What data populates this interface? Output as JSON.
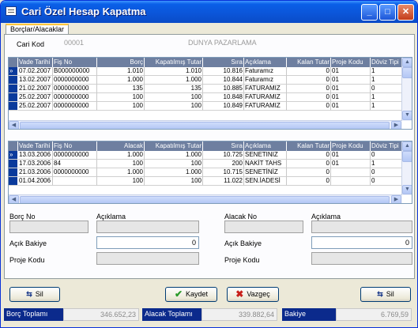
{
  "window": {
    "title": "Cari Özel Hesap Kapatma",
    "minimize": "_",
    "maximize": "□",
    "close": "✕"
  },
  "tab": "Borçlar/Alacaklar",
  "cari": {
    "label": "Cari Kod",
    "code": "00001",
    "name": "DUNYA PAZARLAMA"
  },
  "grid1": {
    "columns": [
      "Vade Tarihi",
      "Fiş No",
      "Borç",
      "Kapatılmış Tutar",
      "Sıra",
      "Açıklama",
      "Kalan Tutar",
      "Proje Kodu",
      "Döviz Tipi"
    ],
    "rows": [
      [
        "07.02.2007",
        "B000000000",
        "1.010",
        "1.010",
        "10.816",
        "Faturamız",
        "0",
        "01",
        "1"
      ],
      [
        "13.02.2007",
        "0000000000",
        "1.000",
        "1.000",
        "10.844",
        "Faturamız",
        "0",
        "01",
        "1"
      ],
      [
        "21.02.2007",
        "0000000000",
        "135",
        "135",
        "10.885",
        "FATURAMIZ",
        "0",
        "01",
        "0"
      ],
      [
        "25.02.2007",
        "0000000000",
        "100",
        "100",
        "10.848",
        "FATURAMIZ",
        "0",
        "01",
        "1"
      ],
      [
        "25.02.2007",
        "0000000000",
        "100",
        "100",
        "10.849",
        "FATURAMIZ",
        "0",
        "01",
        "1"
      ]
    ]
  },
  "grid2": {
    "columns": [
      "Vade Tarihi",
      "Fiş No",
      "Alacak",
      "Kapatılmış Tutar",
      "Sıra",
      "Açıklama",
      "Kalan Tutar",
      "Proje Kodu",
      "Döviz Tipi"
    ],
    "rows": [
      [
        "13.03.2006",
        "0000000000",
        "1.000",
        "1.000",
        "10.725",
        "SENETINIZ",
        "0",
        "01",
        "0"
      ],
      [
        "17.03.2006",
        "84",
        "100",
        "100",
        "200",
        "NAKİT TAHS",
        "0",
        "01",
        "1"
      ],
      [
        "21.03.2006",
        "0000000000",
        "1.000",
        "1.000",
        "10.715",
        "SENETİNİZ",
        "0",
        "",
        "0"
      ],
      [
        "01.04.2006",
        "",
        "100",
        "100",
        "11.022",
        "SEN.İADESİ",
        "0",
        "",
        "0"
      ]
    ]
  },
  "form": {
    "borc_no": "Borç No",
    "borc_aciklama": "Açıklama",
    "borc_bakiye_label": "Açık Bakiye",
    "borc_bakiye": "0",
    "borc_proje": "Proje Kodu",
    "alacak_no": "Alacak No",
    "alacak_aciklama": "Açıklama",
    "alacak_bakiye_label": "Açık Bakiye",
    "alacak_bakiye": "0",
    "alacak_proje": "Proje Kodu"
  },
  "buttons": {
    "sil_left": "Sil",
    "kaydet": "Kaydet",
    "vazgec": "Vazgeç",
    "sil_right": "Sil"
  },
  "status": {
    "borc_label": "Borç Toplamı",
    "borc_value": "346.652,23",
    "alacak_label": "Alacak Toplamı",
    "alacak_value": "339.882,64",
    "bakiye_label": "Bakiye",
    "bakiye_value": "6.769,59"
  }
}
